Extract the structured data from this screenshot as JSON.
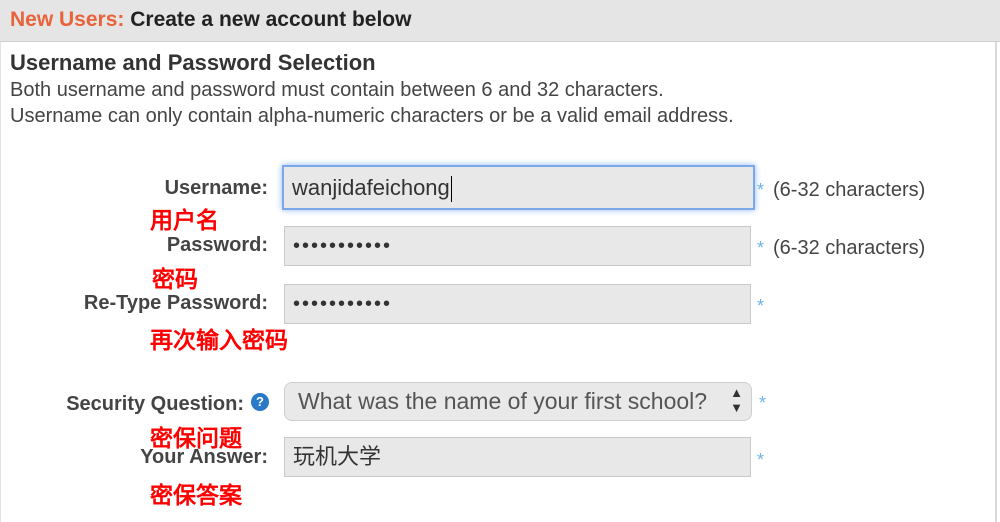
{
  "header": {
    "accent": "New Users:",
    "title": " Create a new account below"
  },
  "section": {
    "title": "Username and Password Selection",
    "line1": "Both username and password must contain between 6 and 32 characters.",
    "line2": "Username can only contain alpha-numeric characters or be a valid email address."
  },
  "form": {
    "username": {
      "label": "Username:",
      "value": "wanjidafeichong",
      "note": "用户名",
      "hint": "(6-32 characters)"
    },
    "password": {
      "label": "Password:",
      "value": "•••••••••••",
      "note": "密码",
      "hint": "(6-32 characters)"
    },
    "retype": {
      "label": "Re-Type Password:",
      "value": "•••••••••••",
      "note": "再次输入密码"
    },
    "security": {
      "label": "Security Question:",
      "help": "?",
      "selected": "What was the name of your first school?",
      "note": "密保问题"
    },
    "answer": {
      "label": "Your Answer:",
      "value": "玩机大学",
      "note": "密保答案"
    },
    "required_mark": "*"
  },
  "colors": {
    "accent": "#e8623a",
    "note": "#ff0000",
    "focus": "#7aa8e8",
    "star": "#6cb4e8"
  }
}
